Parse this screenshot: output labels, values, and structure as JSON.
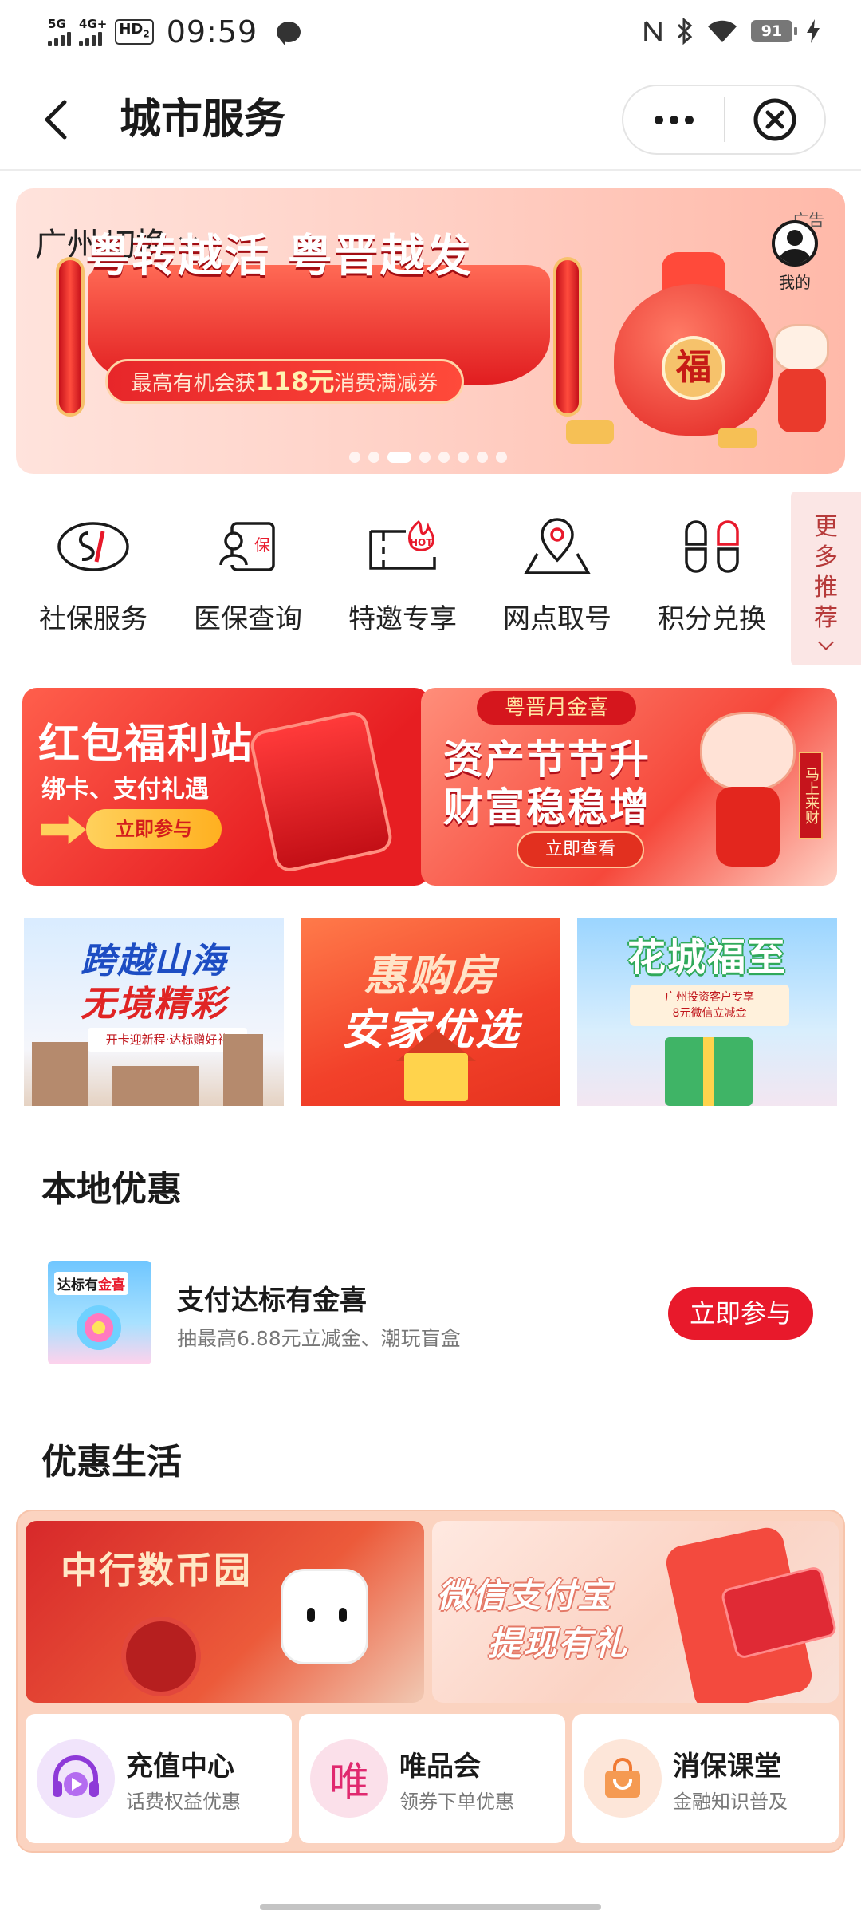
{
  "status_bar": {
    "network1": "5G",
    "network2": "4G+",
    "hd_label": "HD",
    "hd_sub": "2",
    "time": "09:59",
    "battery": "91"
  },
  "header": {
    "title": "城市服务"
  },
  "banner": {
    "city": "广州",
    "switch_label": "切换",
    "headline": "粤转越活 粤晋越发",
    "sub_prefix": "最高有机会获",
    "sub_amount": "118元",
    "sub_suffix": "消费满减券",
    "ad_tag": "广告",
    "mine_label": "我的",
    "fu_char": "福",
    "page_count": 8,
    "active_index": 2
  },
  "services": [
    {
      "label": "社保服务",
      "icon": "social-security-icon"
    },
    {
      "label": "医保查询",
      "icon": "medical-insurance-icon"
    },
    {
      "label": "特邀专享",
      "icon": "hot-ticket-icon"
    },
    {
      "label": "网点取号",
      "icon": "location-pin-icon"
    },
    {
      "label": "积分兑换",
      "icon": "points-exchange-icon"
    }
  ],
  "more_recommend": {
    "chars": [
      "更",
      "多",
      "推",
      "荐"
    ]
  },
  "promos": {
    "redpacket": {
      "title": "红包福利站",
      "subtitle": "绑卡、支付礼遇",
      "button": "立即参与"
    },
    "wealth": {
      "cap": "粤晋月金喜",
      "line1": "资产节节升",
      "line2": "财富稳稳增",
      "button": "立即查看",
      "sign": "马上来财"
    }
  },
  "tiles": [
    {
      "line1": "跨越山海",
      "line2": "无境精彩",
      "note": "开卡迎新程·达标赠好礼"
    },
    {
      "line1": "惠购房",
      "line2": "安家优选"
    },
    {
      "line1": "花城福至",
      "note1": "广州投资客户专享",
      "note2": "8元微信立减金"
    }
  ],
  "local_offers": {
    "section_title": "本地优惠",
    "item": {
      "thumb_text_a": "达标有",
      "thumb_text_b": "金喜",
      "name": "支付达标有金喜",
      "desc": "抽最高6.88元立减金、潮玩盲盒",
      "button": "立即参与"
    }
  },
  "life": {
    "section_title": "优惠生活",
    "banner_left": {
      "title": "中行数币园"
    },
    "banner_right": {
      "line1": "微信支付宝",
      "line2": "提现有礼"
    },
    "cards": [
      {
        "title": "充值中心",
        "sub": "话费权益优惠",
        "icon": "play-headphones-icon"
      },
      {
        "title": "唯品会",
        "sub": "领券下单优惠",
        "icon_text": "唯"
      },
      {
        "title": "消保课堂",
        "sub": "金融知识普及",
        "icon": "shopping-bag-icon"
      }
    ]
  },
  "colors": {
    "brand_red": "#e8192b",
    "text_primary": "#1a1a1a",
    "text_secondary": "#777777"
  }
}
